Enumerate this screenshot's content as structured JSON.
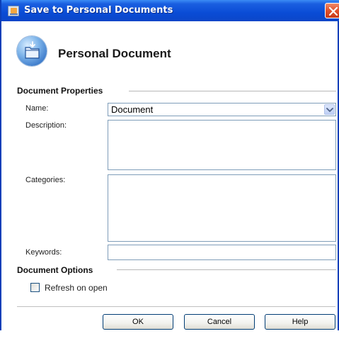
{
  "window": {
    "title": "Save to Personal Documents"
  },
  "header": {
    "title": "Personal Document",
    "icon": "document-folder-icon"
  },
  "document_properties": {
    "section_label": "Document Properties",
    "name_label": "Name:",
    "name_value": "Document",
    "description_label": "Description:",
    "description_value": "",
    "categories_label": "Categories:",
    "categories_value": "",
    "keywords_label": "Keywords:",
    "keywords_value": ""
  },
  "document_options": {
    "section_label": "Document Options",
    "refresh_label": "Refresh on open",
    "refresh_checked": false
  },
  "buttons": {
    "ok": "OK",
    "cancel": "Cancel",
    "help": "Help"
  },
  "colors": {
    "titlebar": "#0a4cd6",
    "close_button": "#e0502a",
    "field_border": "#7f9db9",
    "button_border": "#003c74"
  }
}
